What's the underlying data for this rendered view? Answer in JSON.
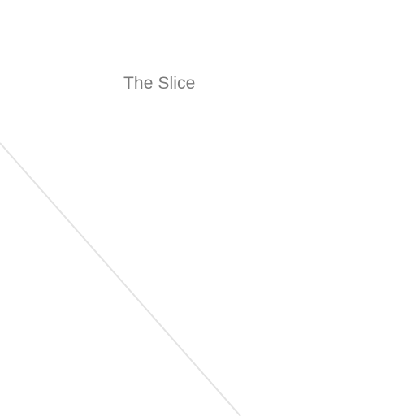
{
  "page": {
    "title": "The Slice"
  },
  "colors": {
    "background": "#ffffff",
    "title_text": "#7a7a7a",
    "divider_line": "#e3e3e3"
  }
}
